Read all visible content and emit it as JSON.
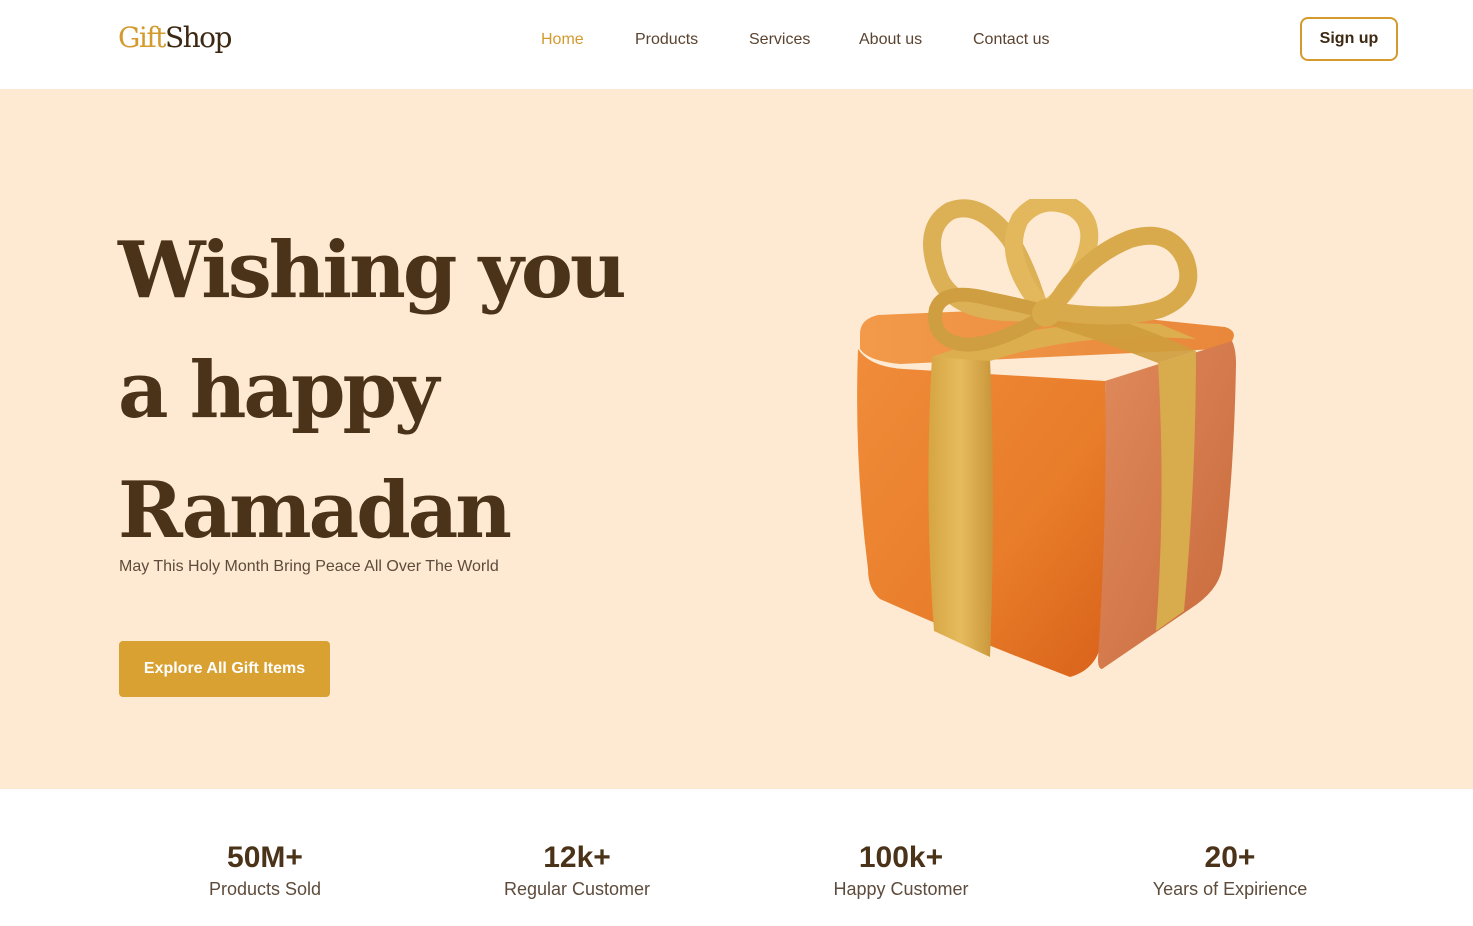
{
  "header": {
    "logo": {
      "part1": "Gift",
      "part2": "Shop"
    },
    "nav": [
      {
        "label": "Home",
        "active": true
      },
      {
        "label": "Products",
        "active": false
      },
      {
        "label": "Services",
        "active": false
      },
      {
        "label": "About us",
        "active": false
      },
      {
        "label": "Contact us",
        "active": false
      }
    ],
    "signup_label": "Sign up"
  },
  "hero": {
    "headline": [
      "Wishing you",
      "a happy",
      "Ramadan"
    ],
    "subtitle": "May This Holy Month Bring Peace All Over The World",
    "cta_label": "Explore All Gift Items",
    "illustration_icon": "gift-box-icon"
  },
  "stats": [
    {
      "value": "50M+",
      "label": "Products Sold"
    },
    {
      "value": "12k+",
      "label": "Regular Customer"
    },
    {
      "value": "100k+",
      "label": "Happy Customer"
    },
    {
      "value": "20+",
      "label": "Years of Expirience"
    }
  ],
  "colors": {
    "accent": "#d59a2e",
    "cta": "#d9a032",
    "hero_background": "#feead2",
    "text_dark": "#4b3319",
    "gift_box": "#ec7f2c",
    "ribbon": "#e0b04d"
  }
}
